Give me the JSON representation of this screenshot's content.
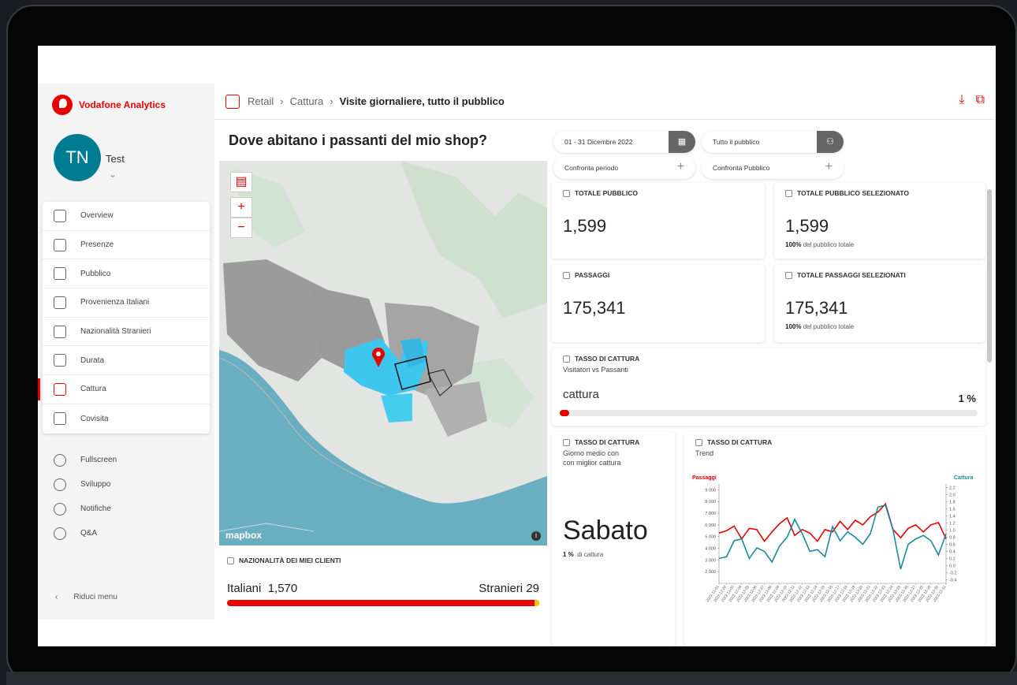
{
  "brand": {
    "name": "Vodafone Analytics"
  },
  "user": {
    "initials": "TN",
    "name": "Test"
  },
  "nav": {
    "items": [
      {
        "label": "Overview",
        "icon": "bar-chart-icon"
      },
      {
        "label": "Presenze",
        "icon": "calendar-list-icon"
      },
      {
        "label": "Pubblico",
        "icon": "people-icon"
      },
      {
        "label": "Provenienza Italiani",
        "icon": "italy-map-icon"
      },
      {
        "label": "Nazionalità Stranieri",
        "icon": "globe-icon"
      },
      {
        "label": "Durata",
        "icon": "clock-icon"
      },
      {
        "label": "Cattura",
        "icon": "capture-bars-icon",
        "active": true
      },
      {
        "label": "Covisita",
        "icon": "eye-icon"
      }
    ],
    "bottom": [
      {
        "label": "Fullscreen",
        "icon": "fullscreen-icon"
      },
      {
        "label": "Sviluppo",
        "icon": "dev-icon"
      },
      {
        "label": "Notifiche",
        "icon": "mail-icon"
      },
      {
        "label": "Q&A",
        "icon": "help-icon"
      }
    ],
    "reduce": "Riduci menu"
  },
  "breadcrumb": {
    "level1": "Retail",
    "level2": "Cattura",
    "current": "Visite giornaliere, tutto il pubblico"
  },
  "map": {
    "title": "Dove abitano i passanti del mio shop?",
    "attribution": "mapbox"
  },
  "nationality": {
    "heading": "NAZIONALITÀ DEI MIEI CLIENTI",
    "italiani_label": "Italiani",
    "italiani_value": "1,570",
    "stranieri_label": "Stranieri",
    "stranieri_value": "29"
  },
  "filters": {
    "period": "01 - 31 Dicembre 2022",
    "audience": "Tutto il pubblico",
    "compare_period": "Confronta periodo",
    "compare_audience": "Confronta Pubblico"
  },
  "stats": {
    "total_public": {
      "label": "TOTALE PUBBLICO",
      "value": "1,599"
    },
    "total_selected": {
      "label": "TOTALE PUBBLICO SELEZIONATO",
      "value": "1,599",
      "pct": "100%",
      "pct_text": "del pubblico totale"
    },
    "passages": {
      "label": "PASSAGGI",
      "value": "175,341"
    },
    "passages_selected": {
      "label": "TOTALE PASSAGGI SELEZIONATI",
      "value": "175,341",
      "pct": "100%",
      "pct_text": "del pubblico totale"
    }
  },
  "capture": {
    "label": "TASSO DI CATTURA",
    "subtitle": "Visitatori vs Passanti",
    "metric": "cattura",
    "value": "1 %",
    "fraction": 0.01
  },
  "best_day": {
    "label": "TASSO DI CATTURA",
    "subtitle1": "Giorno medio con",
    "subtitle2": "con miglior cattura",
    "day": "Sabato",
    "pct": "1 %",
    "pct_text": "di cattura"
  },
  "trend": {
    "label": "TASSO DI CATTURA",
    "subtitle": "Trend"
  },
  "colors": {
    "brand": "#e60000",
    "teal": "#1b8a9a",
    "accent_map": "#3dc7ee"
  },
  "chart_data": {
    "type": "line",
    "title": "",
    "xlabel": "",
    "ylabel": "Passaggi",
    "y2label": "Cattura",
    "ylim": [
      1000,
      9500
    ],
    "y2lim": [
      -0.5,
      2.3
    ],
    "yticks": [
      "9.000",
      "8.000",
      "7.000",
      "6.000",
      "5.000",
      "4.000",
      "3.000",
      "2.000"
    ],
    "y2ticks": [
      "2.2",
      "2.0",
      "1.8",
      "1.6",
      "1.4",
      "1.2",
      "1.0",
      "0.8",
      "0.6",
      "0.4",
      "0.2",
      "0.0",
      "-0.2",
      "-0.4"
    ],
    "x": [
      "2022-12-01",
      "2022-12-02",
      "2022-12-03",
      "2022-12-04",
      "2022-12-05",
      "2022-12-06",
      "2022-12-07",
      "2022-12-08",
      "2022-12-09",
      "2022-12-10",
      "2022-12-11",
      "2022-12-12",
      "2022-12-13",
      "2022-12-14",
      "2022-12-15",
      "2022-12-16",
      "2022-12-17",
      "2022-12-18",
      "2022-12-19",
      "2022-12-20",
      "2022-12-21",
      "2022-12-22",
      "2022-12-23",
      "2022-12-24",
      "2022-12-25",
      "2022-12-26",
      "2022-12-27",
      "2022-12-28",
      "2022-12-29",
      "2022-12-30",
      "2022-12-31"
    ],
    "series": [
      {
        "name": "Passaggi",
        "color": "#e60000",
        "values": [
          5300,
          5500,
          5900,
          4800,
          5700,
          5600,
          4600,
          5400,
          6100,
          6600,
          5100,
          5600,
          5300,
          4600,
          5600,
          5400,
          6300,
          5600,
          6400,
          6000,
          6700,
          7100,
          7800,
          5600,
          4900,
          5700,
          6000,
          5400,
          6000,
          6200,
          4800
        ]
      },
      {
        "name": "Cattura",
        "color": "#1b8a9a",
        "values": [
          0.2,
          0.25,
          0.7,
          0.75,
          0.2,
          0.5,
          0.4,
          0.1,
          0.55,
          0.8,
          1.3,
          0.9,
          0.4,
          0.45,
          0.25,
          1.1,
          0.7,
          0.95,
          0.8,
          0.6,
          0.9,
          1.65,
          1.7,
          1.0,
          -0.1,
          0.6,
          0.75,
          0.85,
          0.7,
          0.3,
          0.9
        ]
      }
    ]
  }
}
